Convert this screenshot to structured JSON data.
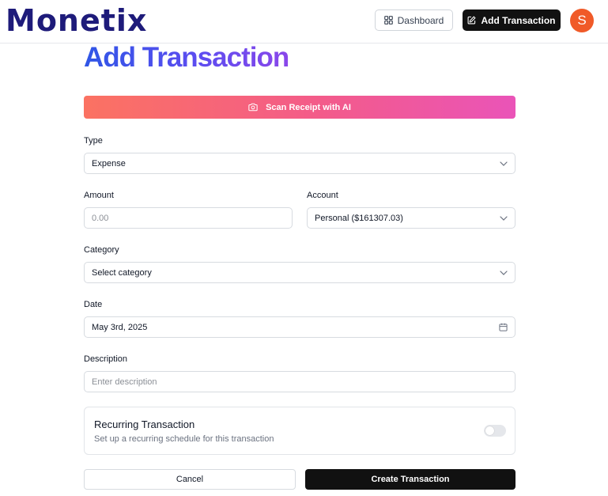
{
  "brand": {
    "logo_text": "Monetix",
    "logo_color": "#1e1b7a"
  },
  "header": {
    "dashboard_label": "Dashboard",
    "dashboard_icon": "layout-dashboard-icon",
    "add_transaction_label": "Add Transaction",
    "add_transaction_icon": "pen-square-icon",
    "avatar_initial": "S",
    "avatar_color": "#f05a28"
  },
  "page": {
    "title": "Add Transaction"
  },
  "scan": {
    "label": "Scan Receipt with AI",
    "icon": "camera-icon"
  },
  "form": {
    "type": {
      "label": "Type",
      "value": "Expense"
    },
    "amount": {
      "label": "Amount",
      "placeholder": "0.00"
    },
    "account": {
      "label": "Account",
      "value": "Personal ($161307.03)"
    },
    "category": {
      "label": "Category",
      "value": "Select category"
    },
    "date": {
      "label": "Date",
      "value": "May 3rd, 2025"
    },
    "description": {
      "label": "Description",
      "placeholder": "Enter description"
    }
  },
  "recurring": {
    "title": "Recurring Transaction",
    "subtitle": "Set up a recurring schedule for this transaction",
    "enabled": false
  },
  "actions": {
    "cancel_label": "Cancel",
    "create_label": "Create Transaction"
  }
}
